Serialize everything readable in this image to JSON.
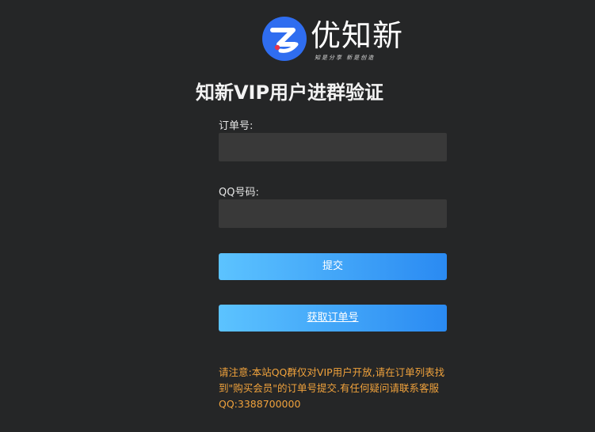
{
  "brand": {
    "logo_icon": "brand-circle-logo-icon",
    "name": "优知新",
    "slogan": "知是分享 新是创造",
    "accent_color": "#2f6df0"
  },
  "page": {
    "title": "知新VIP用户进群验证"
  },
  "form": {
    "order_label": "订单号:",
    "order_value": "",
    "qq_label": "QQ号码:",
    "qq_value": "",
    "submit_label": "提交",
    "get_order_label": "获取订单号"
  },
  "notice": {
    "text": "请注意:本站QQ群仅对VIP用户开放,请在订单列表找到\"购买会员\"的订单号提交.有任何疑问请联系客服QQ:3388700000",
    "color": "#f0a23c"
  },
  "colors": {
    "background": "#252627",
    "input_bg": "#393939",
    "button_gradient_start": "#5cc3ff",
    "button_gradient_end": "#2a8af2"
  }
}
